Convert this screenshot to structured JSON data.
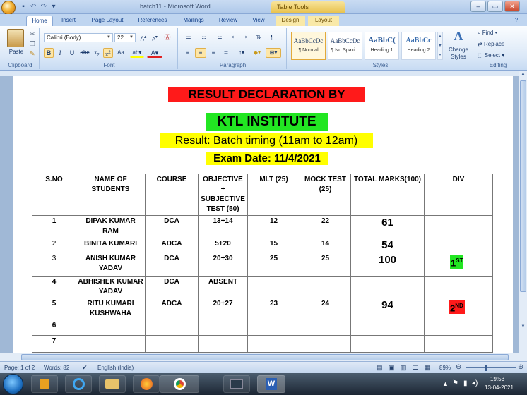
{
  "window": {
    "title": "batch11 - Microsoft Word",
    "context_tab": "Table Tools",
    "controls": [
      "–",
      "▭",
      "✕"
    ]
  },
  "ribbon_tabs": [
    "Home",
    "Insert",
    "Page Layout",
    "References",
    "Mailings",
    "Review",
    "View",
    "Design",
    "Layout"
  ],
  "ribbon": {
    "clipboard": {
      "label": "Clipboard",
      "paste": "Paste"
    },
    "font": {
      "label": "Font",
      "name": "Calibri (Body)",
      "size": "22",
      "bold": "B",
      "italic": "I",
      "underline": "U"
    },
    "paragraph": {
      "label": "Paragraph"
    },
    "styles": {
      "label": "Styles",
      "items": [
        {
          "preview": "AaBbCcDc",
          "name": "¶ Normal"
        },
        {
          "preview": "AaBbCcDc",
          "name": "¶ No Spaci..."
        },
        {
          "preview": "AaBbC(",
          "name": "Heading 1"
        },
        {
          "preview": "AaBbCc",
          "name": "Heading 2"
        }
      ],
      "change_styles": "Change Styles"
    },
    "editing": {
      "label": "Editing",
      "find": "Find",
      "replace": "Replace",
      "select": "Select"
    }
  },
  "document": {
    "heading1": "RESULT DECLARATION BY",
    "heading2": "KTL INSTITUTE",
    "line3": "Result: Batch timing (11am to 12am)",
    "line4": "Exam Date: 11/4/2021",
    "table": {
      "headers": [
        "S.NO",
        "NAME OF STUDENTS",
        "COURSE",
        "OBJECTIVE + SUBJECTIVE TEST (50)",
        "MLT (25)",
        "MOCK TEST (25)",
        "TOTAL MARKS(100)",
        "DIV"
      ],
      "rows": [
        {
          "sno": "1",
          "name": "DIPAK KUMAR RAM",
          "course": "DCA",
          "obj": "13+14",
          "mlt": "12",
          "mock": "22",
          "total": "61",
          "div": ""
        },
        {
          "sno": "2",
          "name": "BINITA  KUMARI",
          "course": "ADCA",
          "obj": "5+20",
          "mlt": "15",
          "mock": "14",
          "total": "54",
          "div": ""
        },
        {
          "sno": "3",
          "name": "ANISH KUMAR YADAV",
          "course": "DCA",
          "obj": "20+30",
          "mlt": "25",
          "mock": "25",
          "total": "100",
          "div": "1",
          "div_sup": "ST"
        },
        {
          "sno": "4",
          "name": "ABHISHEK KUMAR YADAV",
          "course": "DCA",
          "obj": "ABSENT",
          "mlt": "",
          "mock": "",
          "total": "",
          "div": ""
        },
        {
          "sno": "5",
          "name": "RITU KUMARI KUSHWAHA",
          "course": "ADCA",
          "obj": "20+27",
          "mlt": "23",
          "mock": "24",
          "total": "94",
          "div": "2",
          "div_sup": "ND"
        },
        {
          "sno": "6",
          "name": "",
          "course": "",
          "obj": "",
          "mlt": "",
          "mock": "",
          "total": "",
          "div": ""
        },
        {
          "sno": "7",
          "name": "",
          "course": "",
          "obj": "",
          "mlt": "",
          "mock": "",
          "total": "",
          "div": ""
        }
      ]
    }
  },
  "status_bar": {
    "page": "Page: 1 of 2",
    "words": "Words: 82",
    "language": "English (India)",
    "zoom": "89%"
  },
  "taskbar": {
    "time": "19:53",
    "date": "13-04-2021"
  },
  "colors": {
    "heading1_bg": "#ff1a1a",
    "heading2_bg": "#22e622",
    "highlight_yellow": "#ffff00",
    "div1_bg": "#22e622",
    "div2_bg": "#ff1a1a"
  }
}
